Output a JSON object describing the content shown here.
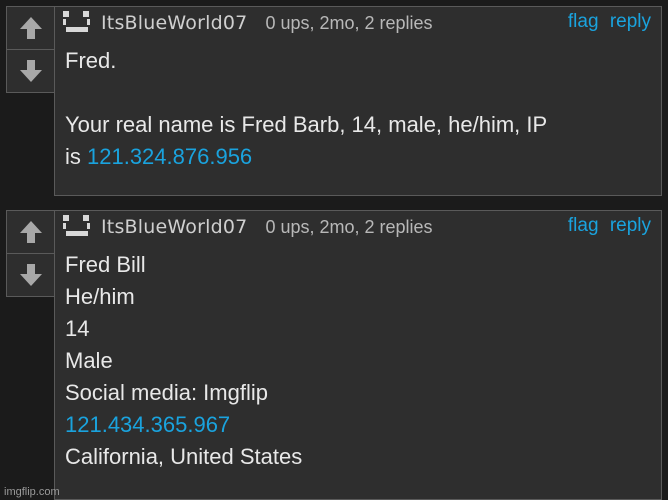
{
  "comments": [
    {
      "username": "ItsBlueWorld07",
      "meta": "0 ups, 2mo, 2 replies",
      "flag": "flag",
      "reply": "reply",
      "line1": "Fred.",
      "line2": "Your real name is Fred Barb, 14, male, he/him, IP",
      "line3_prefix": "is ",
      "ip": "121.324.876.956"
    },
    {
      "username": "ItsBlueWorld07",
      "meta": "0 ups, 2mo, 2 replies",
      "flag": "flag",
      "reply": "reply",
      "lines": [
        "Fred Bill",
        "He/him",
        "14",
        "Male",
        "Social media: Imgflip"
      ],
      "ip": "121.434.365.967",
      "location": "California, United States"
    }
  ],
  "watermark": "imgflip.com",
  "colors": {
    "link": "#1aa3de",
    "panel": "#2e2e2e",
    "border": "#5a5a5a"
  },
  "icons": [
    "upvote-arrow-icon",
    "downvote-arrow-icon",
    "avatar-face-icon"
  ]
}
